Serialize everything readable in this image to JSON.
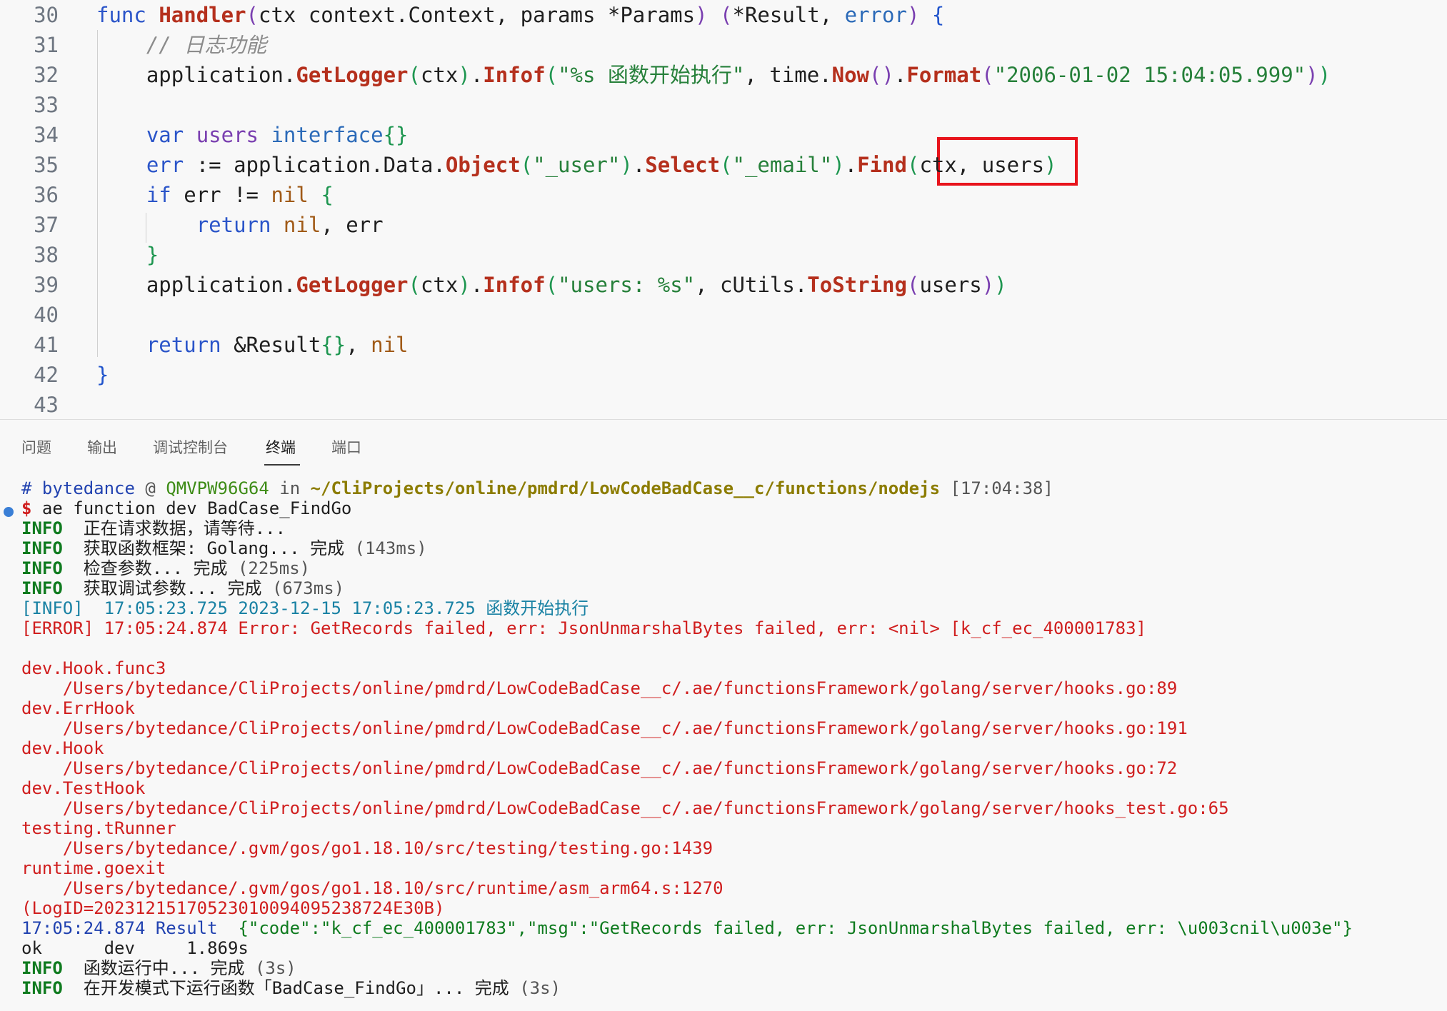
{
  "editor": {
    "lines": [
      {
        "num": "30",
        "tokens": [
          [
            "kw",
            "func "
          ],
          [
            "fn",
            "Handler"
          ],
          [
            "br2",
            "("
          ],
          [
            "pl",
            "ctx context.Context, params *Params"
          ],
          [
            "br2",
            ")"
          ],
          [
            "pl",
            " "
          ],
          [
            "br2",
            "("
          ],
          [
            "pl",
            "*Result, "
          ],
          [
            "tp",
            "error"
          ],
          [
            "br2",
            ")"
          ],
          [
            "pl",
            " "
          ],
          [
            "br1",
            "{"
          ]
        ]
      },
      {
        "num": "31",
        "tokens": [
          [
            "pl",
            "    "
          ],
          [
            "cm",
            "// 日志功能"
          ]
        ]
      },
      {
        "num": "32",
        "tokens": [
          [
            "pl",
            "    application."
          ],
          [
            "fn",
            "GetLogger"
          ],
          [
            "br3",
            "("
          ],
          [
            "pl",
            "ctx"
          ],
          [
            "br3",
            ")"
          ],
          [
            "pl",
            "."
          ],
          [
            "fn",
            "Infof"
          ],
          [
            "br3",
            "("
          ],
          [
            "str",
            "\"%s 函数开始执行\""
          ],
          [
            "pl",
            ", time."
          ],
          [
            "fn",
            "Now"
          ],
          [
            "br2",
            "()"
          ],
          [
            "pl",
            "."
          ],
          [
            "fn",
            "Format"
          ],
          [
            "br2",
            "("
          ],
          [
            "str",
            "\"2006-01-02 15:04:05.999\""
          ],
          [
            "br2",
            ")"
          ],
          [
            "br3",
            ")"
          ]
        ]
      },
      {
        "num": "33",
        "tokens": []
      },
      {
        "num": "34",
        "tokens": [
          [
            "pl",
            "    "
          ],
          [
            "kw",
            "var "
          ],
          [
            "br2",
            "users "
          ],
          [
            "tp",
            "interface"
          ],
          [
            "br3",
            "{}"
          ]
        ]
      },
      {
        "num": "35",
        "tokens": [
          [
            "pl",
            "    "
          ],
          [
            "kw",
            "err"
          ],
          [
            "pl",
            " := application.Data."
          ],
          [
            "fn",
            "Object"
          ],
          [
            "br3",
            "("
          ],
          [
            "str",
            "\"_user\""
          ],
          [
            "br3",
            ")"
          ],
          [
            "pl",
            "."
          ],
          [
            "fn",
            "Select"
          ],
          [
            "br3",
            "("
          ],
          [
            "str",
            "\"_email\""
          ],
          [
            "br3",
            ")"
          ],
          [
            "pl",
            "."
          ],
          [
            "fn",
            "Find"
          ],
          [
            "br3",
            "("
          ],
          [
            "pl",
            "ctx, users"
          ],
          [
            "br3",
            ")"
          ]
        ]
      },
      {
        "num": "36",
        "tokens": [
          [
            "pl",
            "    "
          ],
          [
            "kw",
            "if "
          ],
          [
            "pl",
            "err != "
          ],
          [
            "nl",
            "nil"
          ],
          [
            "pl",
            " "
          ],
          [
            "br3",
            "{"
          ]
        ]
      },
      {
        "num": "37",
        "tokens": [
          [
            "pl",
            "        "
          ],
          [
            "kw",
            "return "
          ],
          [
            "nl",
            "nil"
          ],
          [
            "pl",
            ", err"
          ]
        ]
      },
      {
        "num": "38",
        "tokens": [
          [
            "pl",
            "    "
          ],
          [
            "br3",
            "}"
          ]
        ]
      },
      {
        "num": "39",
        "tokens": [
          [
            "pl",
            "    application."
          ],
          [
            "fn",
            "GetLogger"
          ],
          [
            "br3",
            "("
          ],
          [
            "pl",
            "ctx"
          ],
          [
            "br3",
            ")"
          ],
          [
            "pl",
            "."
          ],
          [
            "fn",
            "Infof"
          ],
          [
            "br3",
            "("
          ],
          [
            "str",
            "\"users: %s\""
          ],
          [
            "pl",
            ", cUtils."
          ],
          [
            "fn",
            "ToString"
          ],
          [
            "br2",
            "("
          ],
          [
            "pl",
            "users"
          ],
          [
            "br2",
            ")"
          ],
          [
            "br3",
            ")"
          ]
        ]
      },
      {
        "num": "40",
        "tokens": []
      },
      {
        "num": "41",
        "tokens": [
          [
            "pl",
            "    "
          ],
          [
            "kw",
            "return "
          ],
          [
            "pl",
            "&Result"
          ],
          [
            "br3",
            "{}"
          ],
          [
            "pl",
            ", "
          ],
          [
            "nl",
            "nil"
          ]
        ]
      },
      {
        "num": "42",
        "tokens": [
          [
            "br1",
            "}"
          ]
        ]
      },
      {
        "num": "43",
        "tokens": []
      }
    ]
  },
  "panel": {
    "tabs": [
      {
        "label": "问题"
      },
      {
        "label": "输出"
      },
      {
        "label": "调试控制台"
      },
      {
        "label": "终端"
      },
      {
        "label": "端口"
      }
    ]
  },
  "terminal": {
    "lines": [
      [
        [
          "t-blue",
          "# "
        ],
        [
          "t-blue",
          "bytedance"
        ],
        [
          "t-gray",
          " @ "
        ],
        [
          "t-host",
          "QMVPW96G64"
        ],
        [
          "t-gray",
          " in "
        ],
        [
          "t-path",
          "~/CliProjects/online/pmdrd/LowCodeBadCase__c/functions/nodejs"
        ],
        [
          "t-gray",
          " [17:04:38]"
        ]
      ],
      [
        [
          "t-dollar",
          "$ "
        ],
        [
          "pl",
          "ae function dev BadCase_FindGo"
        ]
      ],
      [
        [
          "t-info",
          "INFO"
        ],
        [
          "pl",
          "  正在请求数据，请等待..."
        ]
      ],
      [
        [
          "t-info",
          "INFO"
        ],
        [
          "pl",
          "  获取函数框架: Golang... 完成 "
        ],
        [
          "t-gray",
          "(143ms)"
        ]
      ],
      [
        [
          "t-info",
          "INFO"
        ],
        [
          "pl",
          "  检查参数... 完成 "
        ],
        [
          "t-gray",
          "(225ms)"
        ]
      ],
      [
        [
          "t-info",
          "INFO"
        ],
        [
          "pl",
          "  获取调试参数... 完成 "
        ],
        [
          "t-gray",
          "(673ms)"
        ]
      ],
      [
        [
          "t-cyan",
          "[INFO]  17:05:23.725 2023-12-15 17:05:23.725 函数开始执行"
        ]
      ],
      [
        [
          "t-red",
          "[ERROR] 17:05:24.874 Error: GetRecords failed, err: JsonUnmarshalBytes failed, err: <nil> [k_cf_ec_400001783]"
        ]
      ],
      [],
      [
        [
          "t-red",
          "dev.Hook.func3"
        ]
      ],
      [
        [
          "t-red",
          "    /Users/bytedance/CliProjects/online/pmdrd/LowCodeBadCase__c/.ae/functionsFramework/golang/server/hooks.go:89"
        ]
      ],
      [
        [
          "t-red",
          "dev.ErrHook"
        ]
      ],
      [
        [
          "t-red",
          "    /Users/bytedance/CliProjects/online/pmdrd/LowCodeBadCase__c/.ae/functionsFramework/golang/server/hooks.go:191"
        ]
      ],
      [
        [
          "t-red",
          "dev.Hook"
        ]
      ],
      [
        [
          "t-red",
          "    /Users/bytedance/CliProjects/online/pmdrd/LowCodeBadCase__c/.ae/functionsFramework/golang/server/hooks.go:72"
        ]
      ],
      [
        [
          "t-red",
          "dev.TestHook"
        ]
      ],
      [
        [
          "t-red",
          "    /Users/bytedance/CliProjects/online/pmdrd/LowCodeBadCase__c/.ae/functionsFramework/golang/server/hooks_test.go:65"
        ]
      ],
      [
        [
          "t-red",
          "testing.tRunner"
        ]
      ],
      [
        [
          "t-red",
          "    /Users/bytedance/.gvm/gos/go1.18.10/src/testing/testing.go:1439"
        ]
      ],
      [
        [
          "t-red",
          "runtime.goexit"
        ]
      ],
      [
        [
          "t-red",
          "    /Users/bytedance/.gvm/gos/go1.18.10/src/runtime/asm_arm64.s:1270"
        ]
      ],
      [
        [
          "t-red",
          "(LogID=20231215170523010094095238724E30B)"
        ]
      ],
      [
        [
          "t-blue",
          "17:05:24.874 Result  "
        ],
        [
          "t-green",
          "{\"code\":\"k_cf_ec_400001783\",\"msg\":\"GetRecords failed, err: JsonUnmarshalBytes failed, err: \\u003cnil\\u003e\"}"
        ]
      ],
      [
        [
          "pl",
          "ok      dev     1.869s"
        ]
      ],
      [
        [
          "t-info",
          "INFO"
        ],
        [
          "pl",
          "  函数运行中... 完成 "
        ],
        [
          "t-gray",
          "(3s)"
        ]
      ],
      [
        [
          "t-info",
          "INFO"
        ],
        [
          "pl",
          "  在开发模式下运行函数「BadCase_FindGo」... 完成 "
        ],
        [
          "t-gray",
          "(3s)"
        ]
      ]
    ]
  }
}
